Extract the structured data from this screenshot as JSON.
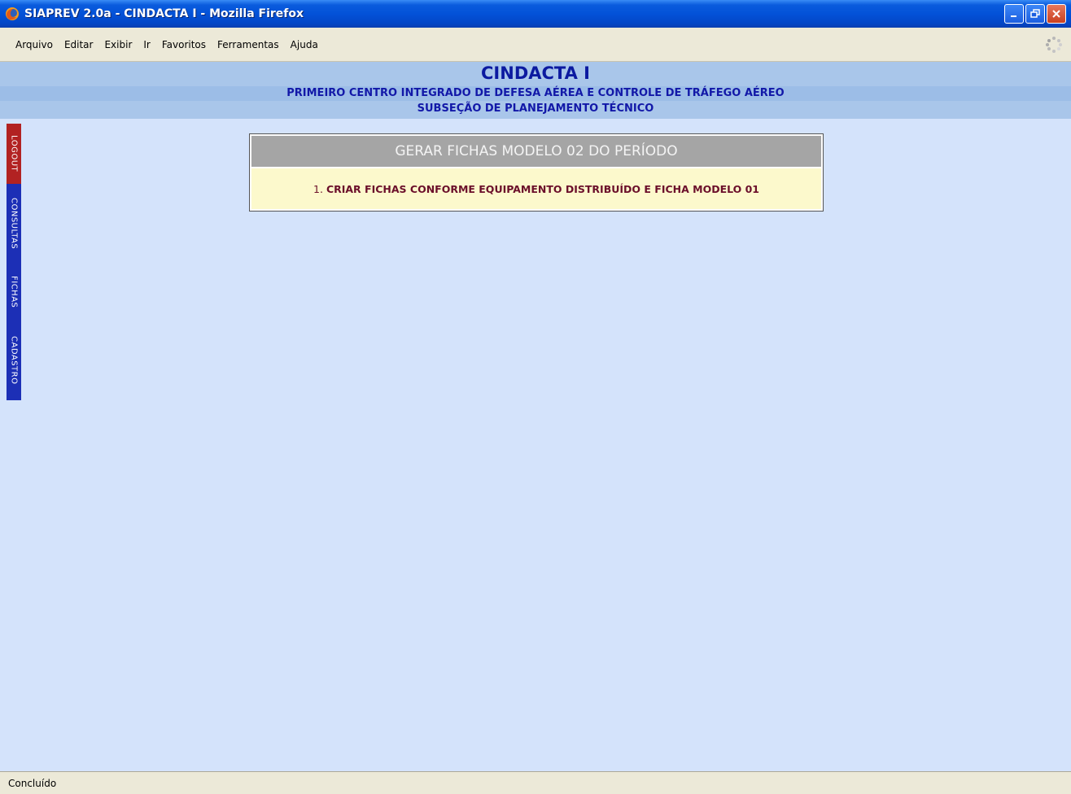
{
  "window": {
    "title": "SIAPREV 2.0a - CINDACTA I - Mozilla Firefox"
  },
  "menu": {
    "items": [
      "Arquivo",
      "Editar",
      "Exibir",
      "Ir",
      "Favoritos",
      "Ferramentas",
      "Ajuda"
    ]
  },
  "header": {
    "title": "CINDACTA I",
    "subtitle": "PRIMEIRO CENTRO INTEGRADO DE DEFESA AÉREA E CONTROLE DE TRÁFEGO AÉREO",
    "section": "SUBSEÇÃO DE PLANEJAMENTO TÉCNICO"
  },
  "sidebar": {
    "tabs": [
      {
        "label": "LOGOUT",
        "color": "#b22222"
      },
      {
        "label": "CONSULTAS",
        "color": "#1c2fb6"
      },
      {
        "label": "FICHAS",
        "color": "#1c2fb6"
      },
      {
        "label": "CADASTRO",
        "color": "#1c2fb6"
      }
    ]
  },
  "panel": {
    "heading": "GERAR FICHAS MODELO 02 DO PERÍODO",
    "item_number": "1.",
    "item_label": "CRIAR FICHAS CONFORME EQUIPAMENTO DISTRIBUÍDO E FICHA MODELO 01"
  },
  "status": {
    "text": "Concluído"
  },
  "colors": {
    "page_background": "#d4e3fb",
    "header_text": "#0c1aa0",
    "panel_link": "#6b0f2a"
  }
}
